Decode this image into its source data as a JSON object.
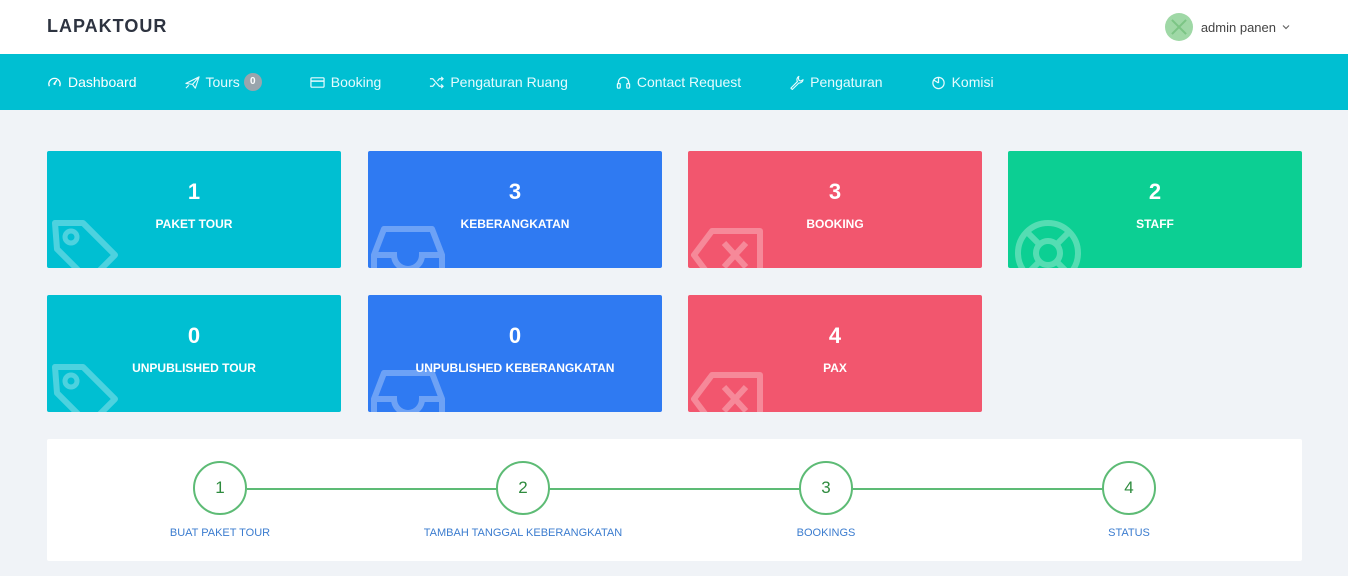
{
  "header": {
    "brand": "LAPAKTOUR",
    "user_name": "admin panen"
  },
  "nav": [
    {
      "label": "Dashboard",
      "icon": "gauge-icon",
      "active": true
    },
    {
      "label": "Tours",
      "icon": "plane-icon",
      "badge": "0"
    },
    {
      "label": "Booking",
      "icon": "credit-card-icon"
    },
    {
      "label": "Pengaturan Ruang",
      "icon": "shuffle-icon"
    },
    {
      "label": "Contact Request",
      "icon": "headset-icon"
    },
    {
      "label": "Pengaturan",
      "icon": "wrench-icon"
    },
    {
      "label": "Komisi",
      "icon": "pie-icon"
    }
  ],
  "stats": [
    {
      "value": "1",
      "label": "PAKET TOUR",
      "color": "#00bfd2",
      "icon": "tag-icon"
    },
    {
      "value": "3",
      "label": "KEBERANGKATAN",
      "color": "#2f7af2",
      "icon": "inbox-icon"
    },
    {
      "value": "3",
      "label": "BOOKING",
      "color": "#f2566e",
      "icon": "backspace-icon"
    },
    {
      "value": "2",
      "label": "STAFF",
      "color": "#0ccf93",
      "icon": "lifebuoy-icon"
    },
    {
      "value": "0",
      "label": "UNPUBLISHED TOUR",
      "color": "#00bfd2",
      "icon": "tag-icon"
    },
    {
      "value": "0",
      "label": "UNPUBLISHED KEBERANGKATAN",
      "color": "#2f7af2",
      "icon": "inbox-icon"
    },
    {
      "value": "4",
      "label": "PAX",
      "color": "#f2566e",
      "icon": "backspace-icon"
    }
  ],
  "steps": [
    {
      "num": "1",
      "label": "BUAT PAKET TOUR"
    },
    {
      "num": "2",
      "label": "TAMBAH TANGGAL KEBERANGKATAN"
    },
    {
      "num": "3",
      "label": "BOOKINGS"
    },
    {
      "num": "4",
      "label": "STATUS"
    }
  ]
}
